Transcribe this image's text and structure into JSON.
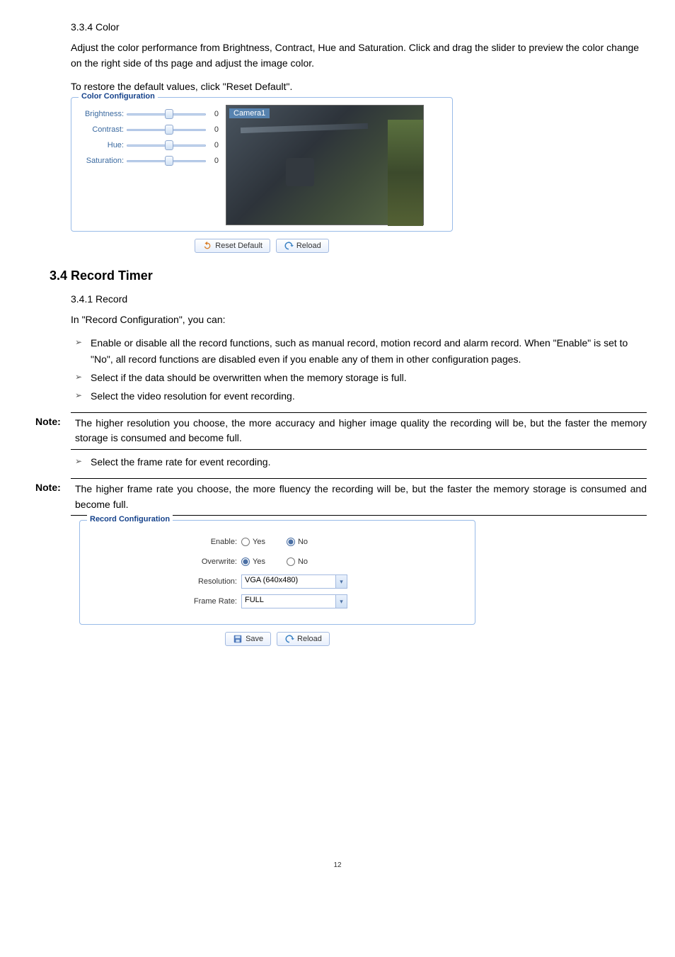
{
  "section_334": {
    "heading": "3.3.4 Color",
    "p1": "Adjust the color performance from Brightness, Contract, Hue and Saturation. Click and drag the slider to preview the color change on the right side of ths page and adjust the image color.",
    "p2": "To restore the default values, click \"Reset Default\"."
  },
  "color_fig": {
    "legend": "Color Configuration",
    "sliders": [
      {
        "label": "Brightness:",
        "value": "0"
      },
      {
        "label": "Contrast:",
        "value": "0"
      },
      {
        "label": "Hue:",
        "value": "0"
      },
      {
        "label": "Saturation:",
        "value": "0"
      }
    ],
    "camera_label": "Camera1",
    "btn_reset": "Reset Default",
    "btn_reload": "Reload"
  },
  "section_34": {
    "heading": "3.4 Record Timer"
  },
  "section_341": {
    "heading": "3.4.1 Record",
    "intro": "In \"Record Configuration\", you can:",
    "bullets_a": [
      "Enable or disable all the record functions, such as manual record, motion record and alarm record. When \"Enable\" is set to \"No\", all record functions are disabled even if you enable any of them in other configuration pages.",
      "Select if the data should be overwritten when the memory storage is full.",
      "Select the video resolution for event recording."
    ],
    "note1_label": "Note:",
    "note1_text": "The higher resolution you choose, the more accuracy and higher image quality the recording will be, but the faster the memory storage is consumed and become full.",
    "bullets_b": [
      "Select the frame rate for event recording."
    ],
    "note2_label": "Note:",
    "note2_text": "The higher frame rate you choose, the more fluency the recording will be, but the faster the memory storage is consumed and become full."
  },
  "rec_fig": {
    "legend": "Record Configuration",
    "enable_label": "Enable:",
    "overwrite_label": "Overwrite:",
    "resolution_label": "Resolution:",
    "framerate_label": "Frame Rate:",
    "yes": "Yes",
    "no": "No",
    "resolution_value": "VGA (640x480)",
    "framerate_value": "FULL",
    "btn_save": "Save",
    "btn_reload": "Reload"
  },
  "page_number": "12"
}
